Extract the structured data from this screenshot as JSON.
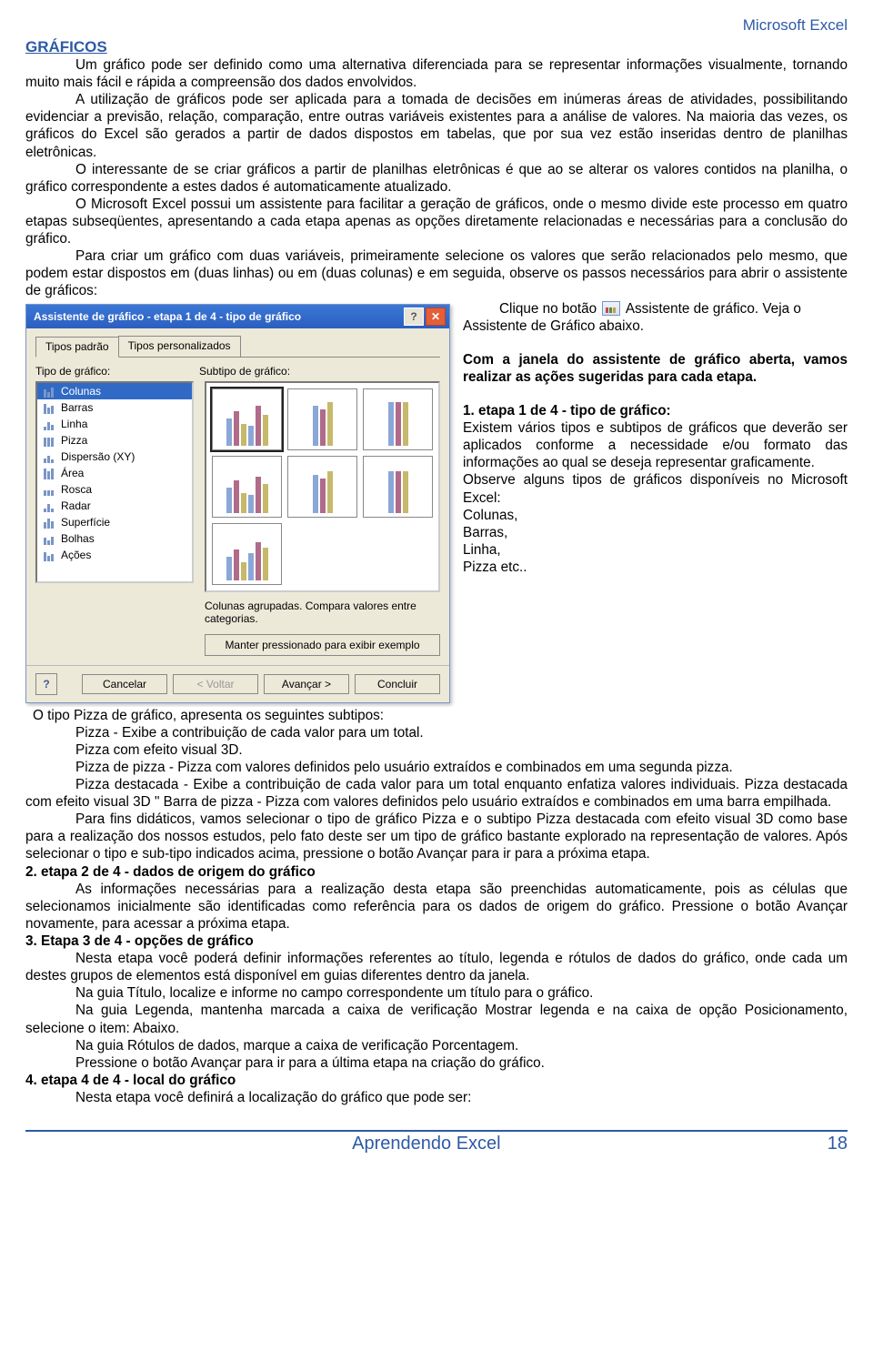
{
  "header": {
    "product": "Microsoft Excel"
  },
  "title": "GRÁFICOS",
  "paragraphs": {
    "p1": "Um gráfico pode ser definido como uma alternativa diferenciada para se representar informações visualmente, tornando muito mais fácil e rápida a compreensão dos dados envolvidos.",
    "p2": "A utilização de gráficos pode ser aplicada para a tomada de decisões em inúmeras áreas de atividades, possibilitando evidenciar a previsão, relação, comparação, entre outras variáveis existentes para a análise de valores. Na maioria das vezes, os gráficos do Excel são gerados a partir de dados dispostos em tabelas, que por sua vez estão inseridas dentro de planilhas eletrônicas.",
    "p3": "O interessante de se criar gráficos a partir de planilhas eletrônicas é que ao se alterar os valores contidos na planilha, o gráfico correspondente a estes dados é automaticamente atualizado.",
    "p4": "O Microsoft Excel possui um assistente para facilitar a geração de gráficos, onde o mesmo divide este processo em quatro etapas subseqüentes, apresentando a cada etapa apenas as opções diretamente relacionadas e necessárias para a conclusão do gráfico.",
    "p5": "Para criar um gráfico com duas variáveis, primeiramente selecione os valores que serão relacionados pelo mesmo, que podem estar dispostos em (duas linhas) ou em (duas colunas) e em seguida, observe os passos necessários para abrir o assistente de gráficos:",
    "click1": "Clique no botão ",
    "click2": " Assistente de gráfico. Veja o Assistente de Gráfico abaixo.",
    "open_hint": "Com a janela do assistente de gráfico aberta, vamos realizar as ações sugeridas para cada etapa.",
    "et1_title": "1. etapa 1 de 4 - tipo de gráfico:",
    "et1_1": "Existem vários tipos e subtipos de gráficos que deverão ser aplicados conforme a necessidade e/ou formato das informações ao qual se deseja representar graficamente.",
    "et1_2": "Observe alguns tipos de gráficos disponíveis no Microsoft Excel:",
    "types": {
      "a": "Colunas,",
      "b": "Barras,",
      "c": "Linha,",
      "d": "Pizza etc.."
    },
    "sub_intro": "O tipo Pizza de gráfico, apresenta os seguintes subtipos:",
    "sub1": "Pizza - Exibe a contribuição de cada valor para um total.",
    "sub2": "Pizza com efeito visual 3D.",
    "sub3": "Pizza de pizza - Pizza com valores definidos pelo usuário extraídos e combinados em uma segunda pizza.",
    "sub4": "Pizza destacada - Exibe a contribuição de cada valor para um total enquanto enfatiza valores individuais. Pizza destacada com efeito visual 3D \" Barra de pizza - Pizza com valores definidos pelo usuário extraídos e combinados em uma barra empilhada.",
    "sub5": "Para fins didáticos, vamos selecionar o tipo de gráfico Pizza e o subtipo Pizza destacada com efeito visual 3D como base para a realização dos nossos estudos, pelo fato deste ser um tipo de gráfico bastante explorado na representação de valores. Após selecionar o tipo e sub-tipo indicados acima, pressione o botão Avançar para ir para a próxima etapa.",
    "et2_title": "2. etapa 2 de 4 - dados de origem do gráfico",
    "et2_1": "As informações necessárias para a realização desta etapa são preenchidas automaticamente, pois as células que selecionamos inicialmente são identificadas como referência para os dados de origem do gráfico. Pressione o botão Avançar novamente, para acessar a próxima etapa.",
    "et3_title": "3. Etapa 3 de 4 - opções de gráfico",
    "et3_1": "Nesta etapa você poderá definir informações referentes ao título, legenda e rótulos de dados do gráfico, onde cada um destes grupos de elementos está disponível em guias diferentes dentro da janela.",
    "et3_2": "Na guia Título, localize e informe no campo correspondente um título para o gráfico.",
    "et3_3": "Na guia Legenda, mantenha marcada a caixa de verificação Mostrar legenda e na caixa de opção Posicionamento, selecione o item: Abaixo.",
    "et3_4": "Na guia Rótulos de dados, marque a caixa de verificação Porcentagem.",
    "et3_5": "Pressione o botão Avançar para ir para a última etapa na criação do gráfico.",
    "et4_title": "4. etapa 4 de 4 - local do gráfico",
    "et4_1": "Nesta etapa você definirá a localização do gráfico que pode ser:"
  },
  "dialog": {
    "title": "Assistente de gráfico - etapa 1 de 4 - tipo de gráfico",
    "tabs": {
      "t1": "Tipos padrão",
      "t2": "Tipos personalizados"
    },
    "labels": {
      "left": "Tipo de gráfico:",
      "right": "Subtipo de gráfico:"
    },
    "list": [
      "Colunas",
      "Barras",
      "Linha",
      "Pizza",
      "Dispersão (XY)",
      "Área",
      "Rosca",
      "Radar",
      "Superfície",
      "Bolhas",
      "Ações"
    ],
    "desc": "Colunas agrupadas. Compara valores entre categorias.",
    "preview": "Manter pressionado para exibir exemplo",
    "buttons": {
      "cancel": "Cancelar",
      "back": "< Voltar",
      "next": "Avançar >",
      "finish": "Concluir",
      "help": "?"
    }
  },
  "footer": {
    "title": "Aprendendo Excel",
    "page": "18"
  }
}
